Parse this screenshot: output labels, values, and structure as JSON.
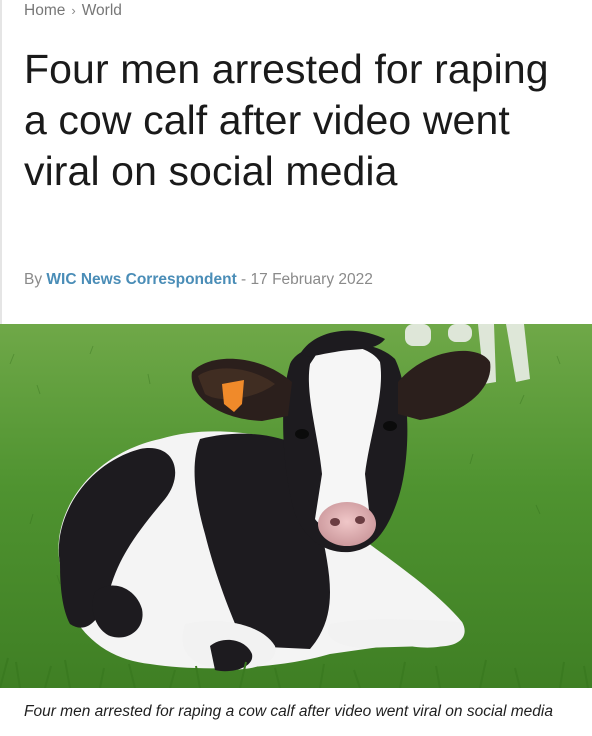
{
  "breadcrumb": {
    "home": "Home",
    "separator": "›",
    "section": "World"
  },
  "article": {
    "headline": "Four men arrested for raping a cow calf after video went viral on social media",
    "byline_prefix": "By",
    "author": "WIC News Correspondent",
    "date_separator": " - ",
    "date": "17 February 2022",
    "caption": "Four men arrested for raping a cow calf after video went viral on social media"
  },
  "colors": {
    "author_link": "#4a8db7",
    "meta_text": "#8a8a8a",
    "grass": "#4d8f2f"
  }
}
